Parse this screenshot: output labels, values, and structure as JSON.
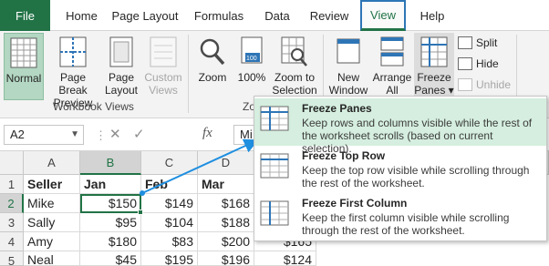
{
  "tabs": [
    {
      "label": "File"
    },
    {
      "label": "Home"
    },
    {
      "label": "Page Layout"
    },
    {
      "label": "Formulas"
    },
    {
      "label": "Data"
    },
    {
      "label": "Review"
    },
    {
      "label": "View"
    },
    {
      "label": "Help"
    }
  ],
  "ribbon": {
    "workbook_views": {
      "group_label": "Workbook Views",
      "normal": [
        "Normal"
      ],
      "page_break": [
        "Page Break",
        "Preview"
      ],
      "page_layout": [
        "Page",
        "Layout"
      ],
      "custom_views": [
        "Custom",
        "Views"
      ]
    },
    "zoom": {
      "group_label_partial": "Zo",
      "zoom": [
        "Zoom"
      ],
      "hundred": [
        "100%"
      ],
      "zoom_to_selection": [
        "Zoom to",
        "Selection"
      ]
    },
    "window": {
      "new_window": [
        "New",
        "Window"
      ],
      "arrange_all": [
        "Arrange",
        "All"
      ],
      "freeze_panes": [
        "Freeze",
        "Panes ▾"
      ],
      "split": "Split",
      "hide": "Hide",
      "unhide": "Unhide"
    }
  },
  "formula_bar": {
    "name_box": "A2",
    "cancel": "✕",
    "enter": "✓",
    "fx": "fx",
    "content_partial": "Mi"
  },
  "sheet": {
    "columns": [
      "A",
      "B",
      "C",
      "D"
    ],
    "rows": [
      "1",
      "2",
      "3",
      "4",
      "5"
    ],
    "headers": [
      "Seller",
      "Jan",
      "Feb",
      "Mar"
    ],
    "data": [
      [
        "Mike",
        "$150",
        "$149",
        "$168"
      ],
      [
        "Sally",
        "$95",
        "$104",
        "$188"
      ],
      [
        "Amy",
        "$180",
        "$83",
        "$200"
      ],
      [
        "Neal",
        "$45",
        "$195",
        "$196"
      ]
    ],
    "partial_column_values": [
      "$165",
      "$124"
    ]
  },
  "freeze_menu": [
    {
      "title": "Freeze Panes",
      "description": "Keep rows and columns visible while the rest of the worksheet scrolls (based on current selection)."
    },
    {
      "title": "Freeze Top Row",
      "description": "Keep the top row visible while scrolling through the rest of the worksheet."
    },
    {
      "title": "Freeze First Column",
      "description": "Keep the first column visible while scrolling through the rest of the worksheet."
    }
  ],
  "colors": {
    "excel_green": "#217346",
    "active_tab_border": "#2e75b6",
    "arrow": "#1f8fe0",
    "menu_highlight": "#d5eedf"
  }
}
